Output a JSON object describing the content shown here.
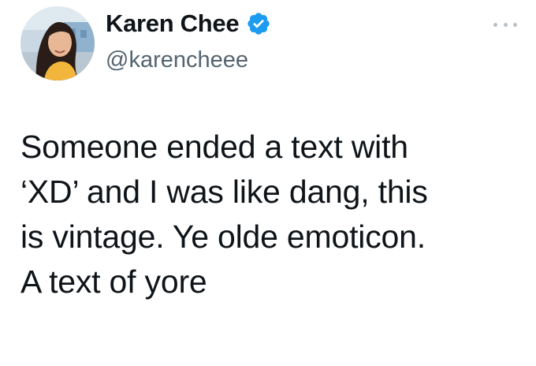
{
  "tweet": {
    "author": {
      "display_name": "Karen Chee",
      "handle": "@karencheee",
      "verified": true,
      "avatar_icon": "profile-photo"
    },
    "more_menu_icon": "more-dots-icon",
    "text_lines": [
      "Someone ended a text with",
      "‘XD’ and I was like dang, this",
      "is vintage. Ye olde emoticon.",
      "A text of yore"
    ]
  },
  "colors": {
    "verified_badge": "#1d9bf0",
    "text_primary": "#0f1419",
    "text_secondary": "#536471"
  }
}
